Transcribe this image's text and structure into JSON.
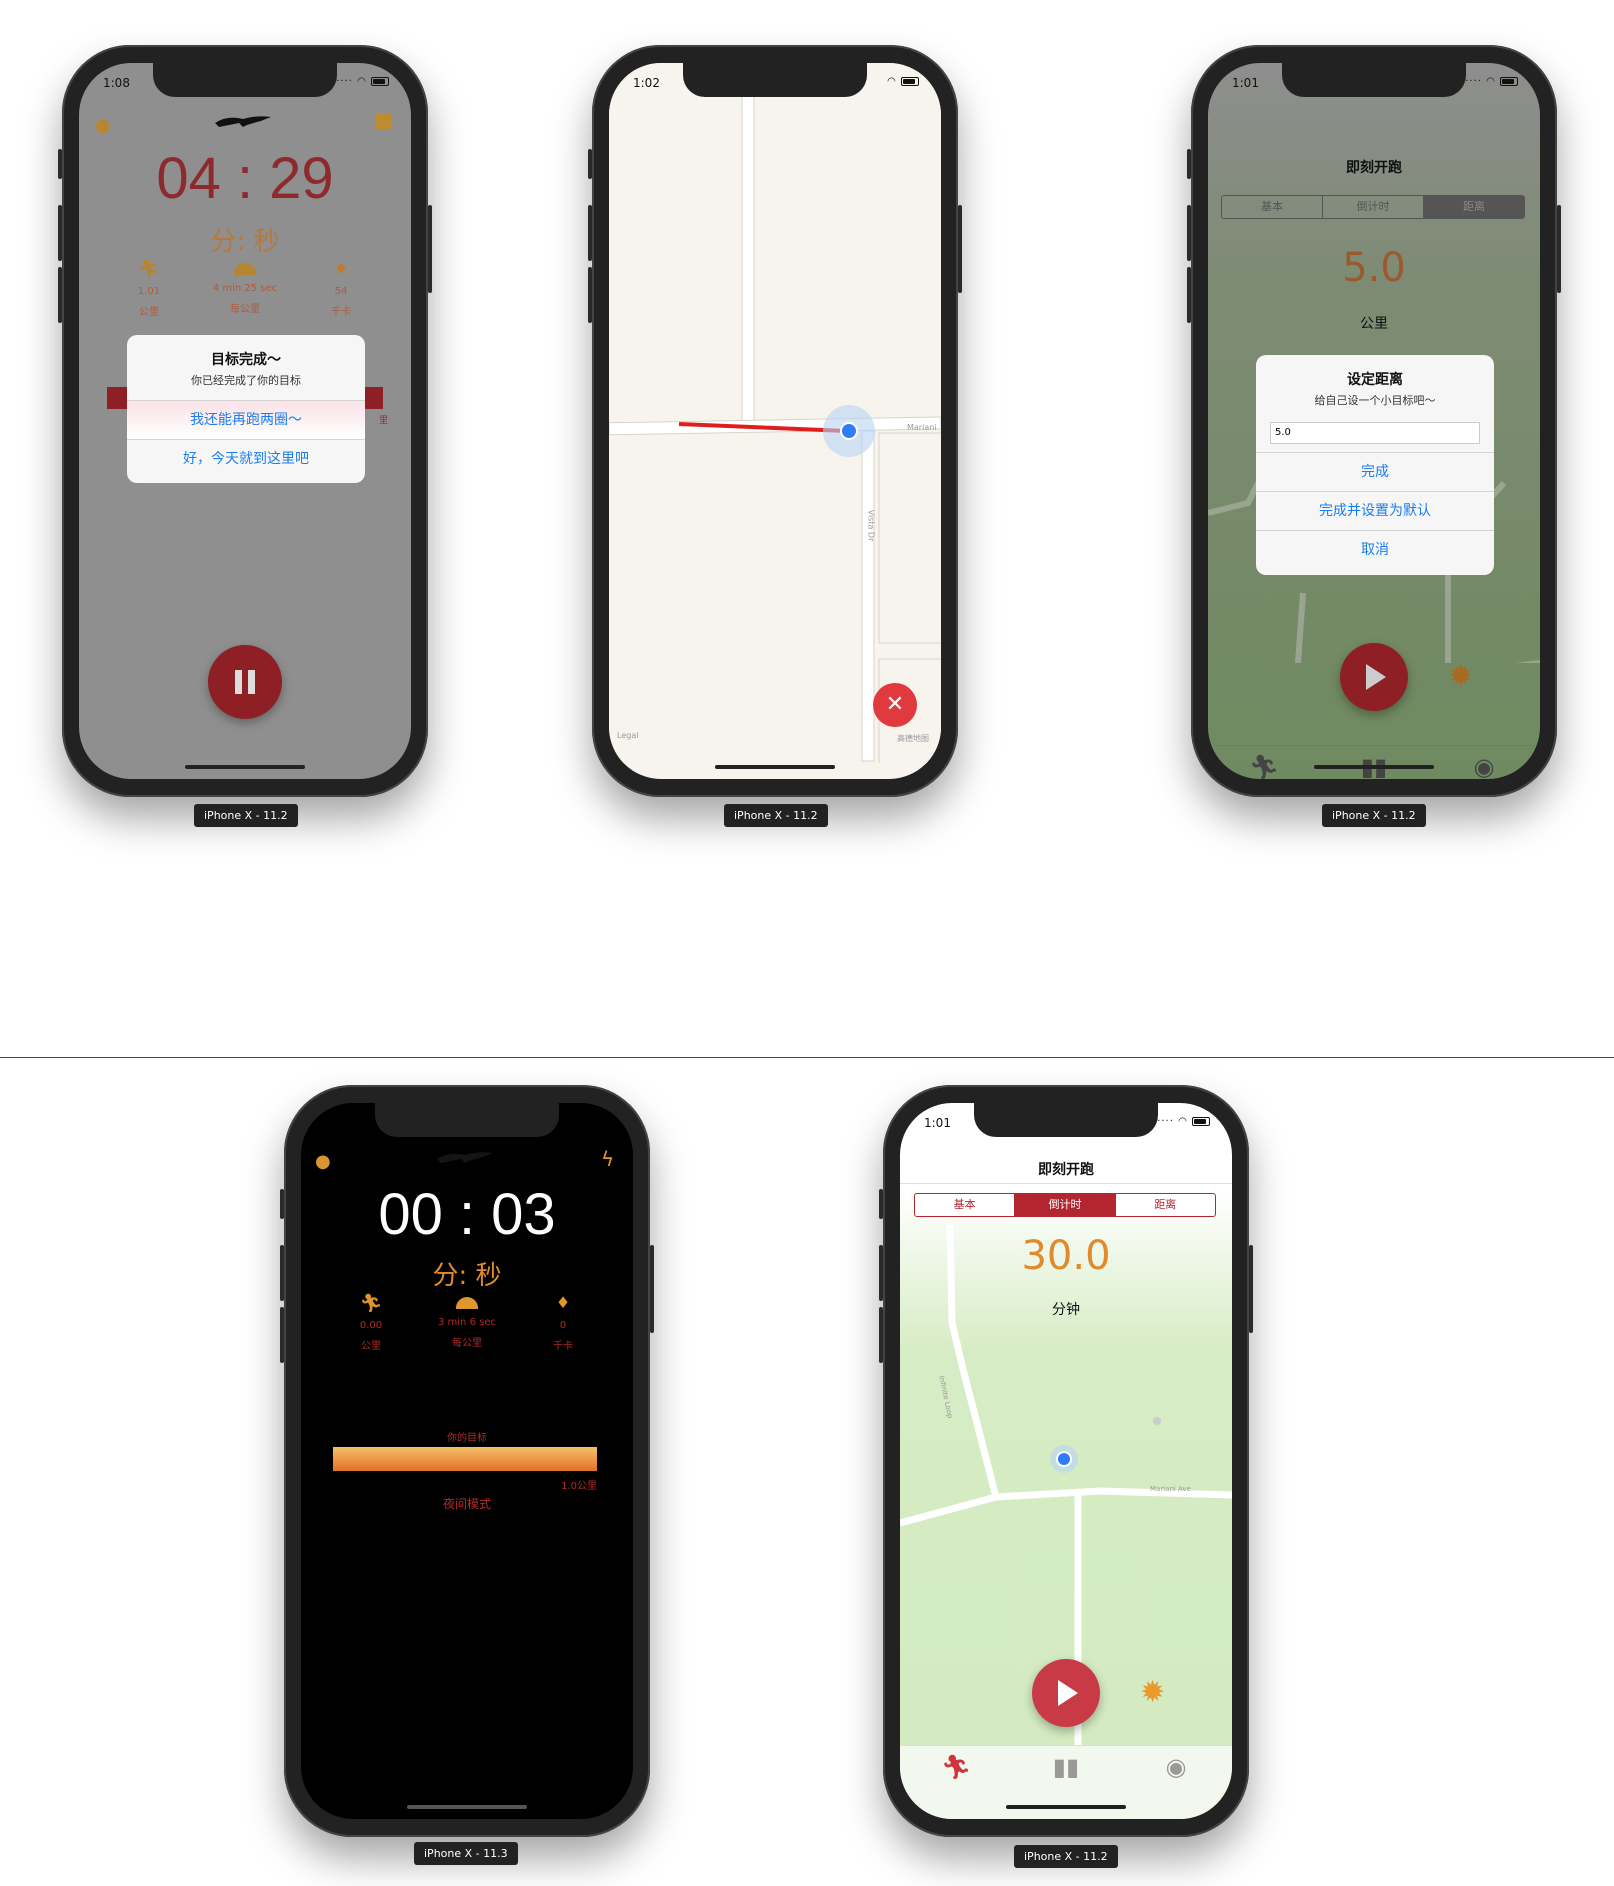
{
  "labels": {
    "p1": "iPhone X - 11.2",
    "p2": "iPhone X - 11.2",
    "p3": "iPhone X - 11.2",
    "p4": "iPhone X - 11.3",
    "p5": "iPhone X - 11.2"
  },
  "p1": {
    "time": "1:08",
    "clock": "04 : 29",
    "unit": "分:  秒",
    "stats": [
      {
        "v": "1.01",
        "u": "公里"
      },
      {
        "v": "4 min 25 sec",
        "u": "每公里"
      },
      {
        "v": "54",
        "u": "千卡"
      }
    ],
    "dialog": {
      "title": "目标完成～",
      "message": "你已经完成了你的目标",
      "btn1": "我还能再跑两圈～",
      "btn2": "好，今天就到这里吧"
    },
    "side_text": "里"
  },
  "p2": {
    "time": "1:02",
    "street1": "Mariani",
    "street2": "Vista Dr",
    "legal": "Legal",
    "attrib": "高德地图"
  },
  "p3": {
    "time": "1:01",
    "title": "即刻开跑",
    "tabs": [
      "基本",
      "倒计时",
      "距离"
    ],
    "value": "5.0",
    "unit": "公里",
    "dialog": {
      "title": "设定距离",
      "message": "给自己设一个小目标吧～",
      "input": "5.0",
      "btn1": "完成",
      "btn2": "完成并设置为默认",
      "btn3": "取消"
    }
  },
  "p4": {
    "clock": "00 : 03",
    "unit": "分:  秒",
    "stats": [
      {
        "v": "0.00",
        "u": "公里"
      },
      {
        "v": "3 min 6 sec",
        "u": "每公里"
      },
      {
        "v": "0",
        "u": "千卡"
      }
    ],
    "goal_label": "你的目标",
    "goal_value": "1.0公里",
    "goal_progress": 1.0,
    "mode": "夜间模式"
  },
  "p5": {
    "time": "1:01",
    "title": "即刻开跑",
    "tabs": [
      "基本",
      "倒计时",
      "距离"
    ],
    "value": "30.0",
    "unit": "分钟",
    "street1": "Mariani Ave",
    "street2": "Infinite Loop"
  },
  "colors": {
    "red": "#b3252f",
    "orange": "#e08a2c",
    "blue": "#1a7ef0"
  }
}
